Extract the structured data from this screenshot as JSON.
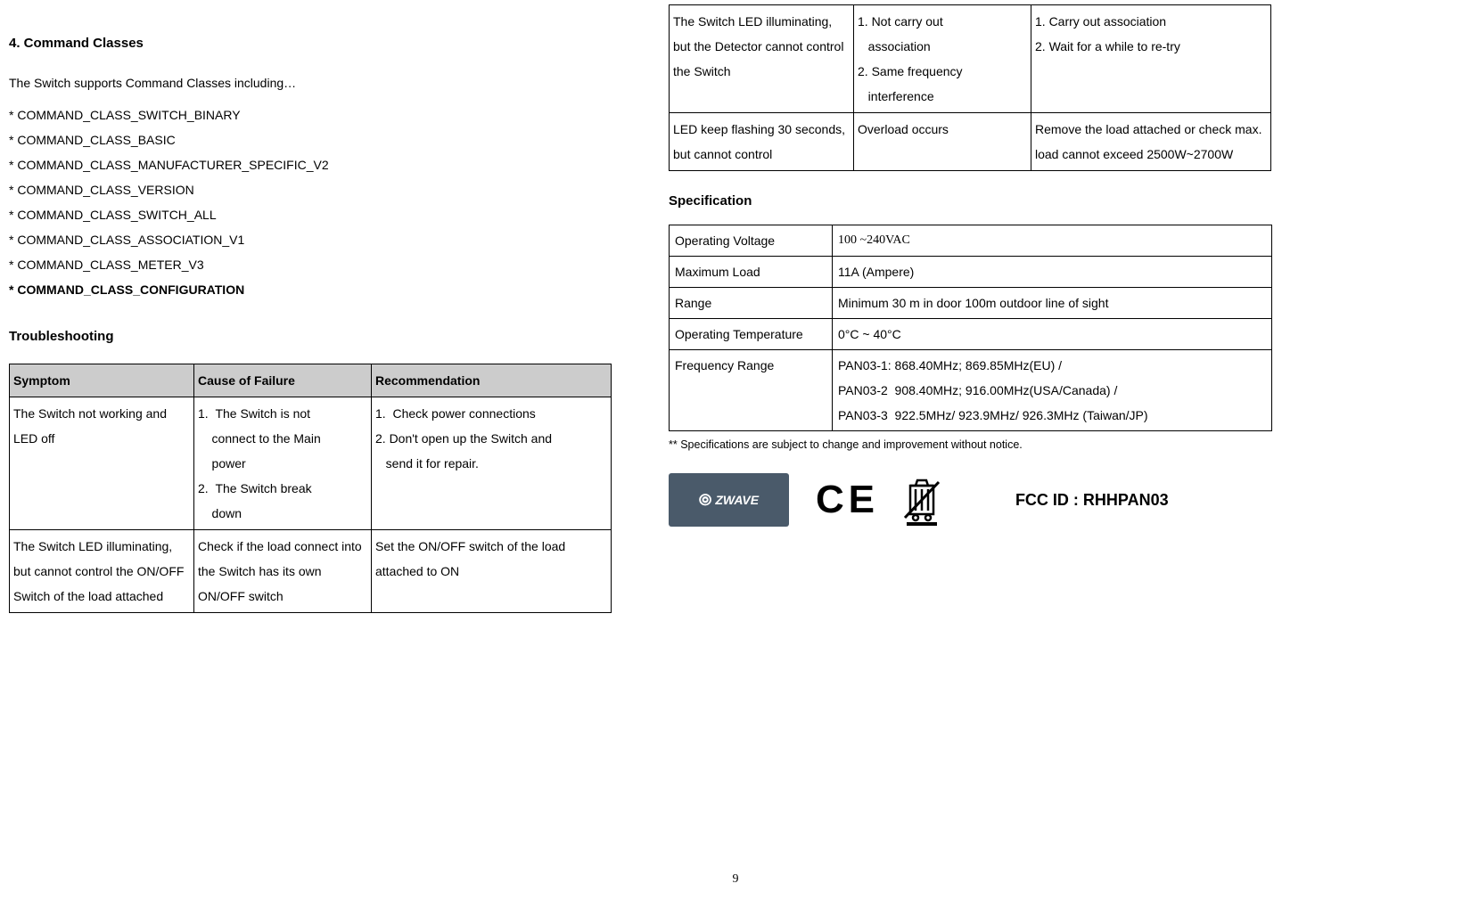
{
  "section4": {
    "heading": "4.    Command Classes",
    "intro": "The Switch supports Command Classes including…",
    "items": [
      "* COMMAND_CLASS_SWITCH_BINARY",
      "* COMMAND_CLASS_BASIC",
      "* COMMAND_CLASS_MANUFACTURER_SPECIFIC_V2",
      "* COMMAND_CLASS_VERSION",
      "* COMMAND_CLASS_SWITCH_ALL",
      "* COMMAND_CLASS_ASSOCIATION_V1",
      "* COMMAND_CLASS_METER_V3",
      "* COMMAND_CLASS_CONFIGURATION"
    ]
  },
  "troubleshooting": {
    "heading": "Troubleshooting",
    "headers": [
      "Symptom",
      "Cause of Failure",
      "Recommendation"
    ],
    "rows_left": [
      {
        "symptom": "The Switch not working and LED off",
        "cause": "1.  The Switch is not connect to the Main power\n2.  The Switch break down",
        "rec": "1.  Check power connections\n2. Don't open up the Switch and send it for repair."
      },
      {
        "symptom": "The Switch LED illuminating, but cannot control the ON/OFF Switch of the load attached",
        "cause": "Check if the load connect into the Switch has its own ON/OFF switch",
        "rec": "Set the ON/OFF switch of the load attached to ON"
      }
    ],
    "rows_right": [
      {
        "symptom": "The Switch LED illuminating, but the Detector cannot control the Switch",
        "cause": "1. Not carry out association\n2. Same frequency interference",
        "rec": "1. Carry out association\n2. Wait for a while to re-try"
      },
      {
        "symptom": "LED keep flashing 30 seconds, but cannot control",
        "cause": "Overload occurs",
        "rec": "Remove the load attached or check max. load cannot exceed 2500W~2700W"
      }
    ]
  },
  "specification": {
    "heading": "Specification",
    "rows": [
      {
        "label": "Operating Voltage",
        "value": "100 ~240VAC"
      },
      {
        "label": "Maximum Load",
        "value": " 11A (Ampere)"
      },
      {
        "label": "Range",
        "value": "Minimum 30 m in door 100m outdoor  line of sight"
      },
      {
        "label": "Operating Temperature",
        "value": "0°C ~ 40°C"
      },
      {
        "label": "Frequency Range",
        "value": "PAN03-1: 868.40MHz; 869.85MHz(EU) /\nPAN03-2  908.40MHz; 916.00MHz(USA/Canada) /\nPAN03-3  922.5MHz/ 923.9MHz/ 926.3MHz (Taiwan/JP)"
      }
    ],
    "footnote": "** Specifications are subject to change and improvement without notice."
  },
  "logos": {
    "zwave": "ZWAVE",
    "ce": "C E",
    "fcc": "FCC ID : RHHPAN03"
  },
  "page_number": "9"
}
